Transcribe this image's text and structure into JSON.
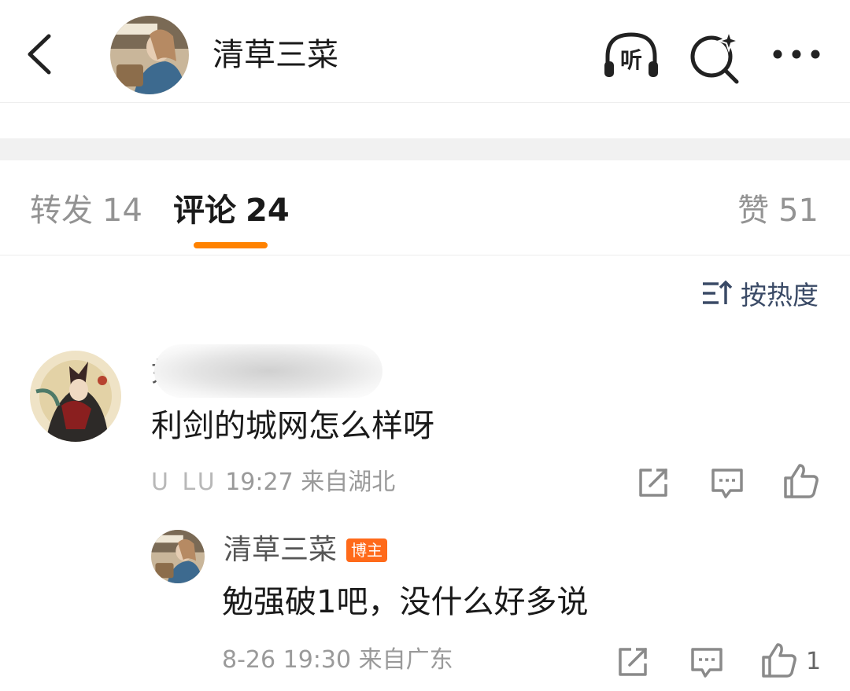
{
  "header": {
    "title": "清草三菜",
    "back_icon": "chevron-left-icon",
    "avatar_icon": "avatar",
    "listen_label": "听",
    "search_icon": "search-sparkle-icon",
    "more_icon": "more-dots-icon"
  },
  "tabs": [
    {
      "label": "转发",
      "count": "14"
    },
    {
      "label": "评论",
      "count": "24"
    },
    {
      "label": "赞",
      "count": "51"
    }
  ],
  "colors": {
    "accent": "#ff8200",
    "badge": "#ff6a1a",
    "sort_text": "#3a4a66"
  },
  "sort": {
    "label": "按热度",
    "icon": "sort-icon"
  },
  "comments": [
    {
      "username_visible": "如",
      "text": "利剑的城网怎么样呀",
      "meta_prefix": "U LU",
      "time": "19:27",
      "location": "来自湖北",
      "actions": [
        "share-icon",
        "comment-icon",
        "like-icon"
      ],
      "reply": {
        "username": "清草三菜",
        "badge": "博主",
        "text": "勉强破1吧，没什么好多说",
        "time": "8-26 19:30",
        "location": "来自广东",
        "like_count": "1"
      }
    }
  ]
}
